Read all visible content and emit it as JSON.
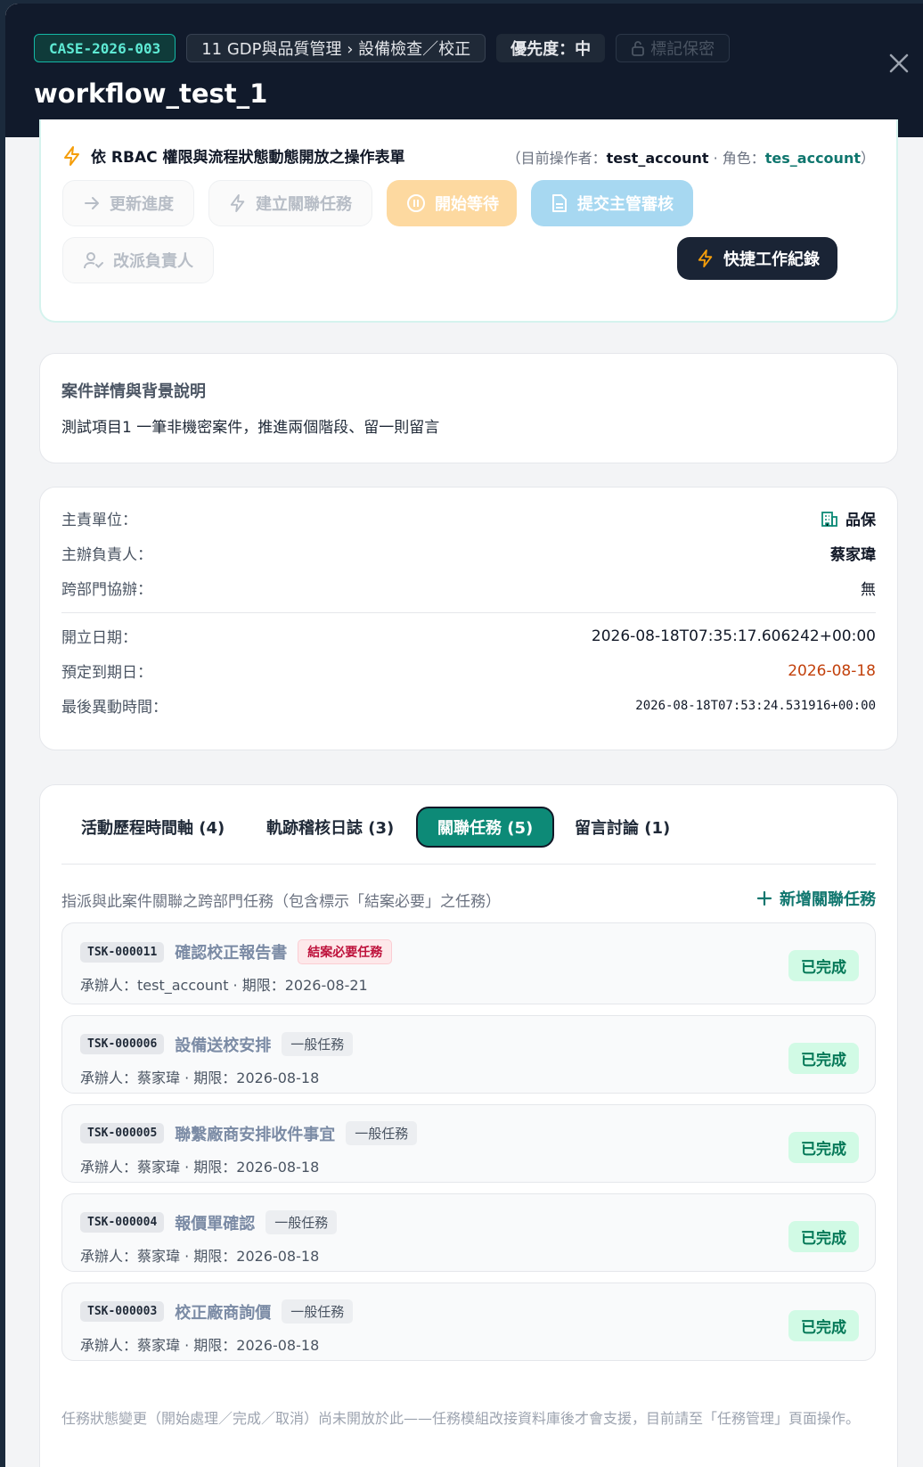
{
  "header": {
    "case_id": "CASE-2026-003",
    "category": "11 GDP與品質管理 › 設備檢查／校正",
    "priority": "優先度：中",
    "confidential": "標記保密",
    "title": "workflow_test_1"
  },
  "actions": {
    "heading": "依 RBAC 權限與流程狀態動態開放之操作表單",
    "operator_prefix": "（目前操作者：",
    "operator": "test_account",
    "role_prefix": " · 角色：",
    "role": "tes_account",
    "operator_suffix": "）",
    "update_progress": "更新進度",
    "create_related": "建立關聯任務",
    "start_wait": "開始等待",
    "submit_review": "提交主管審核",
    "reassign": "改派負責人",
    "quick_log": "快捷工作紀錄"
  },
  "details": {
    "title": "案件詳情與背景說明",
    "text": "測試項目1 一筆非機密案件，推進兩個階段、留一則留言"
  },
  "info": {
    "unit_label": "主責單位：",
    "unit_value": "品保",
    "owner_label": "主辦負責人：",
    "owner_value": "蔡家瑋",
    "cross_label": "跨部門協辦：",
    "cross_value": "無",
    "opened_label": "開立日期：",
    "opened_value": "2026-08-18T07:35:17.606242+00:00",
    "due_label": "預定到期日：",
    "due_value": "2026-08-18",
    "modified_label": "最後異動時間：",
    "modified_value": "2026-08-18T07:53:24.531916+00:00"
  },
  "tabs": {
    "items": [
      "活動歷程時間軸 (4)",
      "軌跡稽核日誌 (3)",
      "關聯任務 (5)",
      "留言討論 (1)"
    ],
    "description": "指派與此案件關聯之跨部門任務（包含標示「結案必要」之任務）",
    "add_label": "新增關聯任務",
    "footnote": "任務狀態變更（開始處理／完成／取消）尚未開放於此——任務模組改接資料庫後才會支援，目前請至「任務管理」頁面操作。"
  },
  "tasks": [
    {
      "code": "TSK-000011",
      "name": "確認校正報告書",
      "tag": "結案必要任務",
      "meta": "承辦人：test_account · 期限：2026-08-21",
      "status": "已完成"
    },
    {
      "code": "TSK-000006",
      "name": "設備送校安排",
      "tag": "一般任務",
      "meta": "承辦人：蔡家瑋 · 期限：2026-08-18",
      "status": "已完成"
    },
    {
      "code": "TSK-000005",
      "name": "聯繫廠商安排收件事宜",
      "tag": "一般任務",
      "meta": "承辦人：蔡家瑋 · 期限：2026-08-18",
      "status": "已完成"
    },
    {
      "code": "TSK-000004",
      "name": "報價單確認",
      "tag": "一般任務",
      "meta": "承辦人：蔡家瑋 · 期限：2026-08-18",
      "status": "已完成"
    },
    {
      "code": "TSK-000003",
      "name": "校正廠商詢價",
      "tag": "一般任務",
      "meta": "承辦人：蔡家瑋 · 期限：2026-08-18",
      "status": "已完成"
    }
  ],
  "colors": {
    "header_bg": "#111a2b",
    "accent": "#0d8a77",
    "due_date": "#c2410c",
    "required_tag": "#be123c",
    "status_done": "#047857"
  },
  "icons": [
    "lock-icon",
    "close-icon",
    "lightning-icon",
    "arrow-right-icon",
    "pause-icon",
    "document-icon",
    "user-check-icon",
    "building-icon",
    "plus-icon"
  ]
}
